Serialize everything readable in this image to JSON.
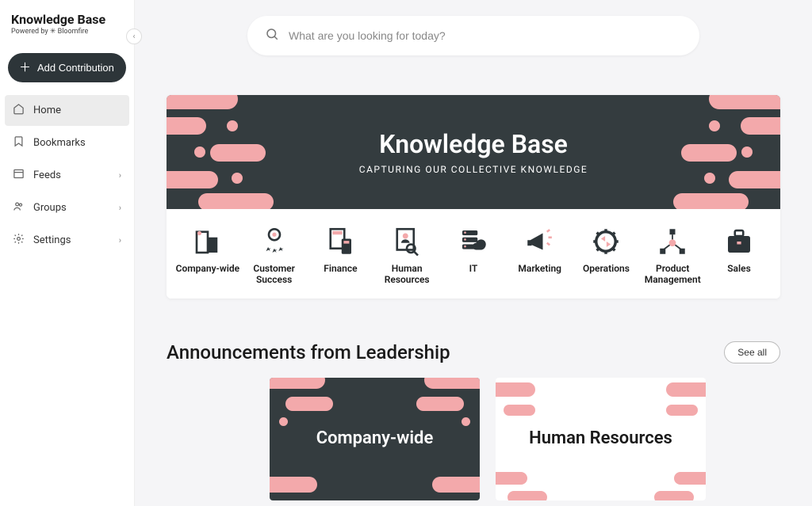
{
  "brand": {
    "title": "Knowledge Base",
    "subtitle": "Powered by ✳ Bloomfire"
  },
  "sidebar": {
    "add_label": "Add Contribution",
    "items": [
      {
        "label": "Home",
        "icon": "home",
        "has_children": false,
        "active": true
      },
      {
        "label": "Bookmarks",
        "icon": "bookmark",
        "has_children": false,
        "active": false
      },
      {
        "label": "Feeds",
        "icon": "feed",
        "has_children": true,
        "active": false
      },
      {
        "label": "Groups",
        "icon": "groups",
        "has_children": true,
        "active": false
      },
      {
        "label": "Settings",
        "icon": "settings",
        "has_children": true,
        "active": false
      }
    ]
  },
  "search": {
    "placeholder": "What are you looking for today?"
  },
  "hero": {
    "title": "Knowledge Base",
    "subtitle": "CAPTURING OUR COLLECTIVE KNOWLEDGE"
  },
  "categories": [
    {
      "label": "Company-wide",
      "icon": "building"
    },
    {
      "label": "Customer Success",
      "icon": "person-stars"
    },
    {
      "label": "Finance",
      "icon": "calculator"
    },
    {
      "label": "Human Resources",
      "icon": "person-search"
    },
    {
      "label": "IT",
      "icon": "server-cloud"
    },
    {
      "label": "Marketing",
      "icon": "megaphone"
    },
    {
      "label": "Operations",
      "icon": "gear-arrows"
    },
    {
      "label": "Product Management",
      "icon": "nodes"
    },
    {
      "label": "Sales",
      "icon": "briefcase"
    }
  ],
  "announcements": {
    "title": "Announcements from Leadership",
    "see_all": "See all",
    "cards": [
      {
        "title": "Company-wide",
        "variant": "dark"
      },
      {
        "title": "Human Resources",
        "variant": "light"
      }
    ]
  },
  "colors": {
    "accent_pink": "#f3a9ab",
    "dark_bg": "#343c3f"
  }
}
